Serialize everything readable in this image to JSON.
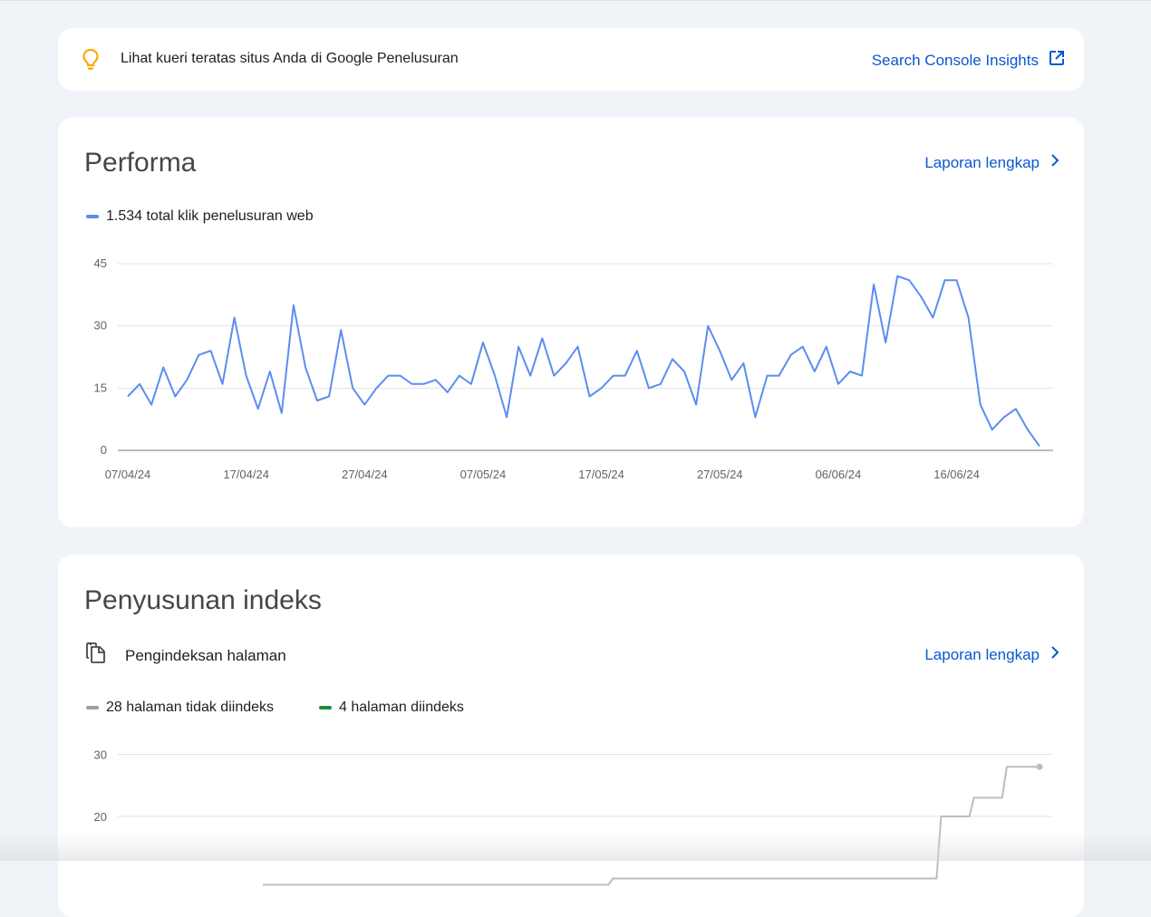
{
  "insight": {
    "text": "Lihat kueri teratas situs Anda di Google Penelusuran",
    "link_label": "Search Console Insights",
    "bulb_icon": "lightbulb-icon",
    "external_icon": "open-in-new-icon",
    "bulb_color": "#f9ab00"
  },
  "performance": {
    "title": "Performa",
    "report_link": "Laporan lengkap",
    "legend_label": "1.534 total klik penelusuran web",
    "line_color": "#5b8def"
  },
  "indexing": {
    "title": "Penyusunan indeks",
    "subheading": "Pengindeksan halaman",
    "subheading_icon": "copy-pages-icon",
    "report_link": "Laporan lengkap",
    "legend": [
      {
        "label": "28 halaman tidak diindeks",
        "color": "#9aa0a6"
      },
      {
        "label": "4 halaman diindeks",
        "color": "#1e8e3e"
      }
    ]
  },
  "chart_data": [
    {
      "type": "line",
      "title": "",
      "xlabel": "",
      "ylabel": "",
      "ylim": [
        0,
        45
      ],
      "yticks": [
        0,
        15,
        30,
        45
      ],
      "xticks": [
        "07/04/24",
        "17/04/24",
        "27/04/24",
        "07/05/24",
        "17/05/24",
        "27/05/24",
        "06/06/24",
        "16/06/24"
      ],
      "grid": true,
      "legend_position": "top-left",
      "series": [
        {
          "name": "1.534 total klik penelusuran web",
          "color": "#5b8def",
          "x_start": "07/04/24",
          "values": [
            13,
            16,
            11,
            20,
            13,
            17,
            23,
            24,
            16,
            32,
            18,
            10,
            19,
            9,
            35,
            20,
            12,
            13,
            29,
            15,
            11,
            15,
            18,
            18,
            16,
            16,
            17,
            14,
            18,
            16,
            26,
            18,
            8,
            25,
            18,
            27,
            18,
            21,
            25,
            13,
            15,
            18,
            18,
            24,
            15,
            16,
            22,
            19,
            11,
            30,
            24,
            17,
            21,
            8,
            18,
            18,
            23,
            25,
            19,
            25,
            16,
            19,
            18,
            40,
            26,
            42,
            41,
            37,
            32,
            41,
            41,
            32,
            11,
            5,
            8,
            10,
            5,
            1
          ]
        }
      ]
    },
    {
      "type": "line",
      "title": "",
      "xlabel": "",
      "ylabel": "",
      "yticks": [
        20,
        30
      ],
      "grid": true,
      "legend_position": "top-left",
      "series": [
        {
          "name": "28 halaman tidak diindeks",
          "color": "#bdbdbd",
          "values": [
            9,
            9,
            9,
            9,
            9,
            9,
            9,
            9,
            9,
            9,
            9,
            9,
            9,
            9,
            9,
            9,
            9,
            9,
            9,
            9,
            9,
            9,
            9,
            9,
            9,
            9,
            9,
            9,
            9,
            9,
            9,
            9,
            10,
            10,
            10,
            10,
            10,
            10,
            10,
            10,
            10,
            10,
            10,
            10,
            10,
            10,
            10,
            10,
            10,
            10,
            10,
            10,
            10,
            10,
            10,
            10,
            10,
            10,
            10,
            10,
            10,
            10,
            20,
            20,
            20,
            23,
            23,
            23,
            28,
            28,
            28,
            28
          ]
        }
      ]
    }
  ]
}
